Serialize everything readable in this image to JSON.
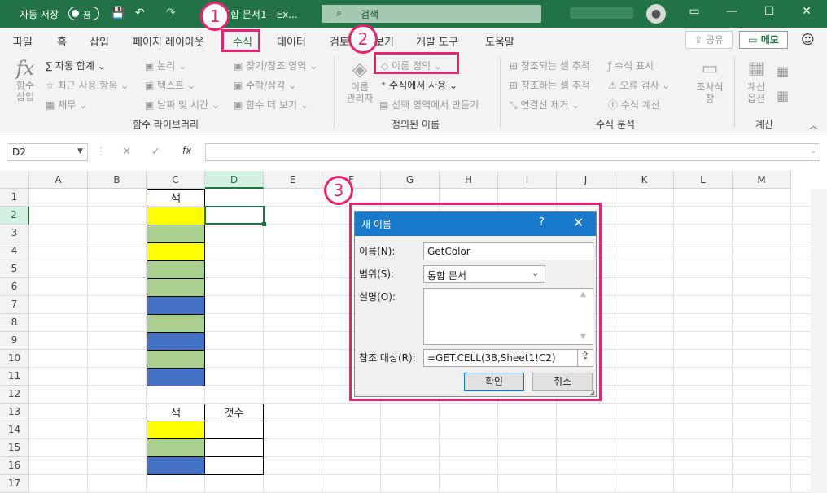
{
  "titlebar": {
    "autosave_label": "자동 저장",
    "toggle_state": "끔",
    "doc_title": "통합 문서1 - Ex...",
    "search_placeholder": "검색",
    "avatar_icon": "user-icon",
    "icons": {
      "save": "💾",
      "undo": "↶",
      "redo": "↷",
      "ribbon_display": "▭",
      "minimize": "—",
      "maximize": "☐",
      "close": "✕"
    }
  },
  "tabs": [
    "파일",
    "홈",
    "삽입",
    "페이지 레이아웃",
    "수식",
    "데이터",
    "검토",
    "보기",
    "개발 도구",
    "도움말"
  ],
  "active_tab": "수식",
  "share_label": "공유",
  "memo_label": "메모",
  "ribbon": {
    "fx_big": "fx",
    "fx_big_label1": "함수",
    "fx_big_label2": "삽입",
    "autosum": "∑ 자동 합계",
    "recent": "최근 사용 항목",
    "finance": "재무",
    "logic": "논리",
    "text": "텍스트",
    "datetime": "날짜 및 시간",
    "lookup": "찾기/참조 영역",
    "math": "수학/삼각",
    "more": "함수 더 보기",
    "group1": "함수 라이브러리",
    "name_mgr1": "이름",
    "name_mgr2": "관리자",
    "define_name": "이름 정의",
    "use_in_formula": "수식에서 사용",
    "create_from_sel": "선택 영역에서 만들기",
    "group2": "정의된 이름",
    "trace_prec": "참조되는 셀 추적",
    "trace_dep": "참조하는 셀 추적",
    "remove_arrows": "연결선 제거",
    "show_formulas": "수식 표시",
    "error_check": "오류 검사",
    "eval_formula": "수식 계산",
    "watch1": "조사식",
    "watch2": "창",
    "group3": "수식 분석",
    "calc_opt1": "계산",
    "calc_opt2": "옵션",
    "group4": "계산"
  },
  "formula_bar": {
    "name_box": "D2",
    "fx": "fx",
    "cancel": "✕",
    "enter": "✓",
    "value": ""
  },
  "columns": [
    "A",
    "B",
    "C",
    "D",
    "E",
    "F",
    "G",
    "H",
    "I",
    "J",
    "K",
    "L",
    "M"
  ],
  "rows": [
    "1",
    "2",
    "3",
    "4",
    "5",
    "6",
    "7",
    "8",
    "9",
    "10",
    "11",
    "12",
    "13",
    "14",
    "15",
    "16",
    "17"
  ],
  "sheet": {
    "c1": "색",
    "c2_colors": [
      "#ffff00",
      "#a9d08e",
      "#ffff00",
      "#a9d08e",
      "#a9d08e",
      "#4472c4",
      "#a9d08e",
      "#4472c4",
      "#a9d08e",
      "#4472c4"
    ],
    "c13": "색",
    "d13": "갯수",
    "c14_colors": [
      "#ffff00",
      "#a9d08e",
      "#4472c4"
    ]
  },
  "dialog": {
    "title": "새 이름",
    "help": "?",
    "close": "✕",
    "name_label": "이름(N):",
    "name_value": "GetColor",
    "scope_label": "범위(S):",
    "scope_value": "통합 문서",
    "comment_label": "설명(O):",
    "comment_value": "",
    "ref_label": "참조 대상(R):",
    "ref_value": "=GET.CELL(38,Sheet1!C2)",
    "ok": "확인",
    "cancel": "취소"
  },
  "callouts": [
    "1",
    "2",
    "3"
  ],
  "accent": "#217346",
  "callout_color": "#e9216e"
}
